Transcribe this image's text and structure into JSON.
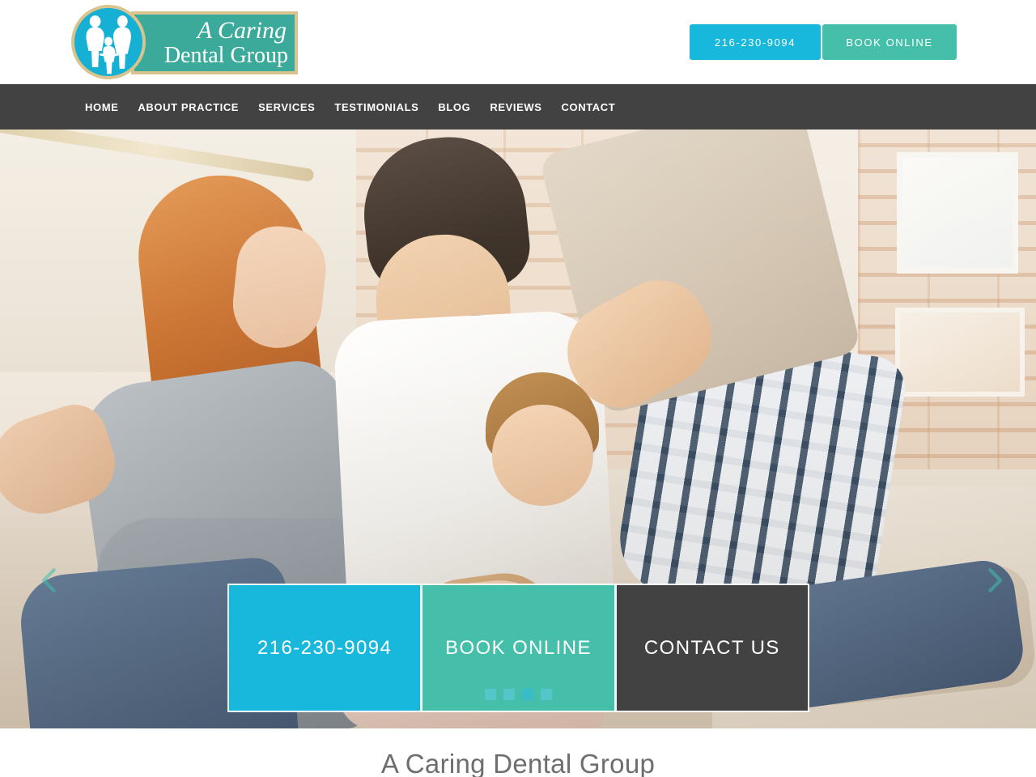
{
  "brand": {
    "logo_line1": "A Caring",
    "logo_line2": "Dental Group",
    "mark_alt": "family-silhouette-logo",
    "colors": {
      "cyan": "#17b8dc",
      "teal": "#45bfaa",
      "dark": "#424242",
      "logo_gold": "#d8c48c",
      "logo_circle": "#16b0d4",
      "logo_banner": "#3caa9b"
    }
  },
  "header": {
    "phone_button": "216-230-9094",
    "book_button": "BOOK ONLINE"
  },
  "nav": {
    "items": [
      {
        "label": "HOME"
      },
      {
        "label": "ABOUT PRACTICE"
      },
      {
        "label": "SERVICES"
      },
      {
        "label": "TESTIMONIALS"
      },
      {
        "label": "BLOG"
      },
      {
        "label": "REVIEWS"
      },
      {
        "label": "CONTACT"
      }
    ]
  },
  "hero": {
    "prev_arrow": "chevron-left-icon",
    "next_arrow": "chevron-right-icon",
    "cta": [
      {
        "label": "216-230-9094",
        "style": "cyan"
      },
      {
        "label": "BOOK ONLINE",
        "style": "teal"
      },
      {
        "label": "CONTACT US",
        "style": "dark"
      }
    ],
    "dots": [
      {
        "active": false
      },
      {
        "active": false
      },
      {
        "active": true
      },
      {
        "active": false
      }
    ]
  },
  "main": {
    "section_title": "A Caring Dental Group"
  }
}
